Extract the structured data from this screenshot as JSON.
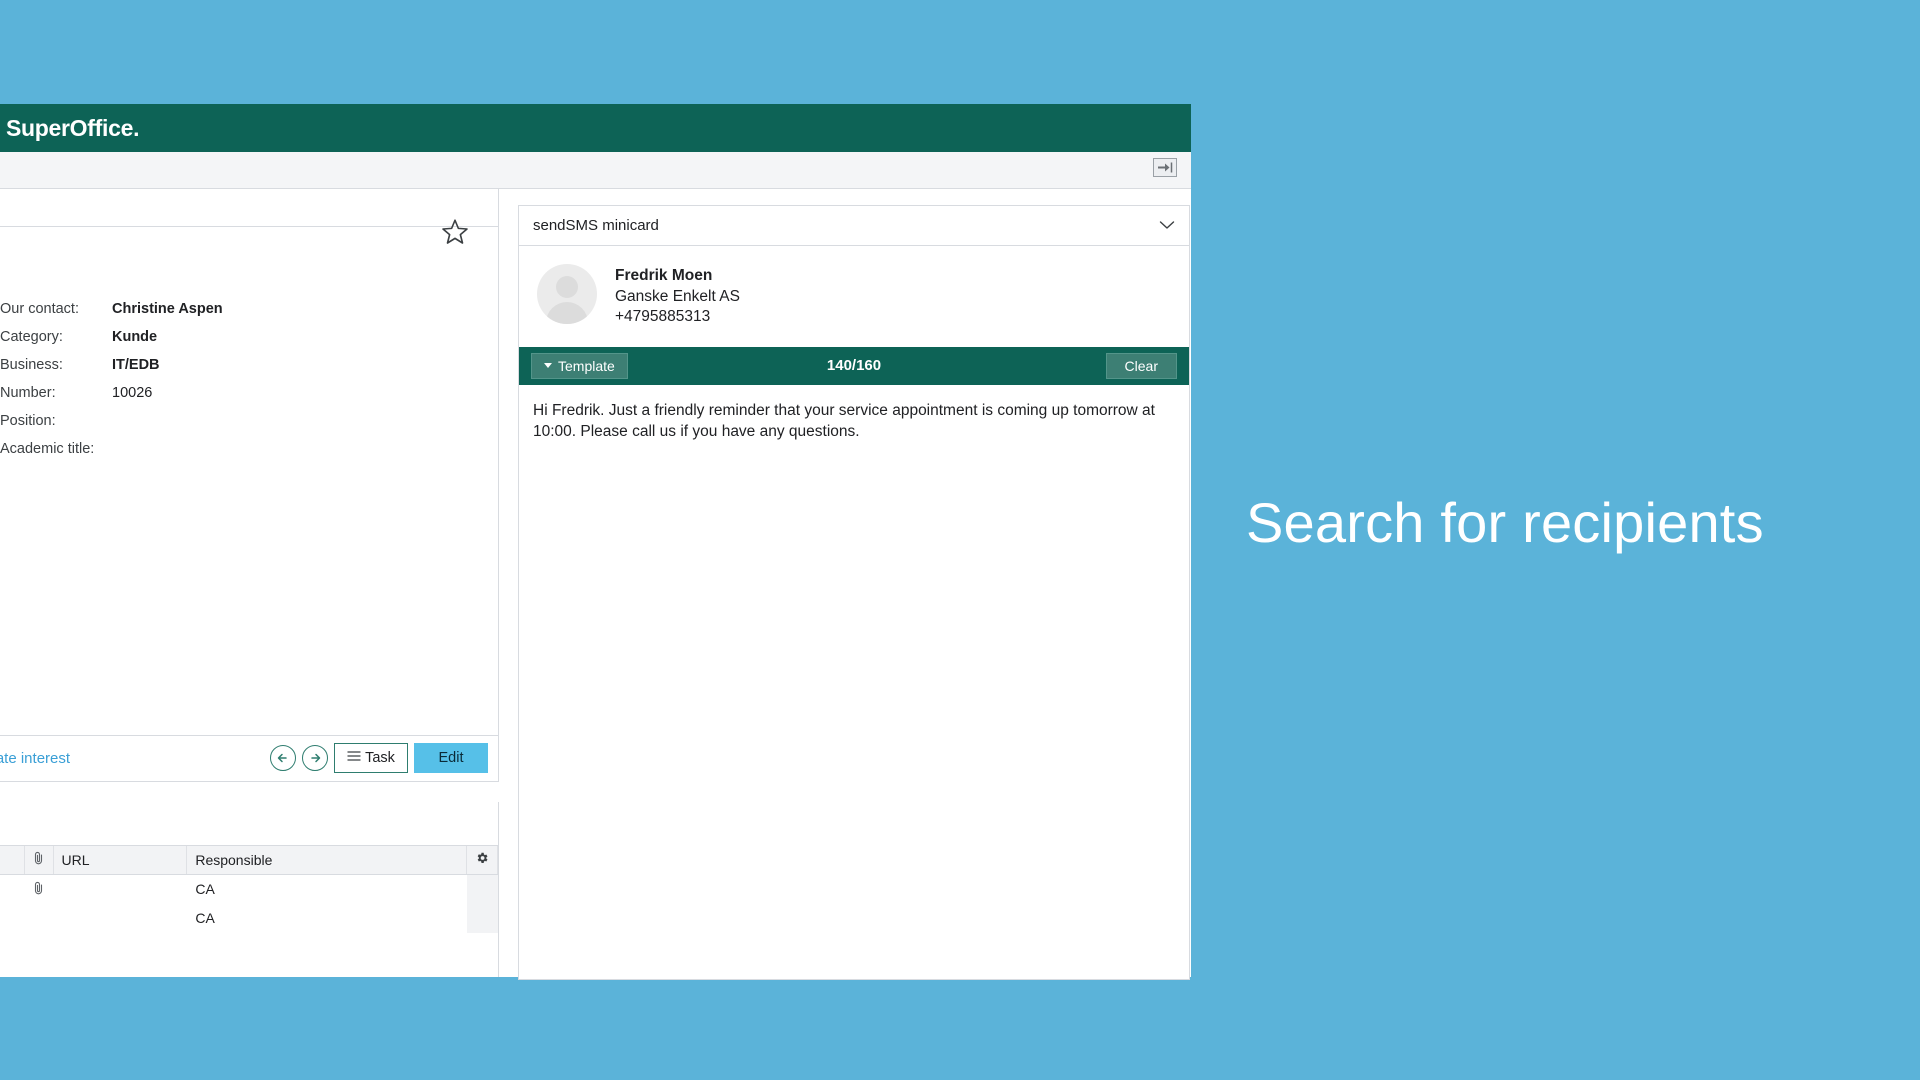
{
  "app": {
    "logo_text": "SuperOffice",
    "logo_dot": ".",
    "expand_icon": "expand-panel-icon"
  },
  "contact_card": {
    "star_icon": "favorite-star-icon",
    "fields": [
      {
        "label": "Our contact:",
        "value": "Christine Aspen"
      },
      {
        "label": "Category:",
        "value": "Kunde"
      },
      {
        "label": "Business:",
        "value": "IT/EDB"
      },
      {
        "label": "Number:",
        "value": "10026"
      },
      {
        "label": "Position:",
        "value": ""
      },
      {
        "label": "Academic title:",
        "value": ""
      }
    ],
    "actions": {
      "interest_link": "imate interest",
      "prev_icon": "arrow-left-icon",
      "next_icon": "arrow-right-icon",
      "task_label": "Task",
      "task_icon": "hamburger-menu-icon",
      "edit_label": "Edit"
    }
  },
  "documents_table": {
    "gear_icon": "settings-gear-icon",
    "clip_icon": "paperclip-icon",
    "columns": [
      "",
      "",
      "URL",
      "Responsible",
      ""
    ],
    "rows": [
      {
        "clip": "paperclip-icon",
        "url": "",
        "responsible": "CA"
      },
      {
        "clip": "",
        "url": "",
        "responsible": "CA"
      }
    ]
  },
  "sms_panel": {
    "title": "sendSMS minicard",
    "collapse_icon": "chevron-down-icon",
    "avatar_icon": "person-avatar-icon",
    "contact": {
      "name": "Fredrik Moen",
      "company": "Ganske Enkelt AS",
      "phone": "+4795885313"
    },
    "toolbar": {
      "template_label": "Template",
      "template_caret": "caret-down-icon",
      "char_count": "140/160",
      "clear_label": "Clear"
    },
    "message": "Hi Fredrik. Just a friendly reminder that your service appointment is coming up tomorrow at 10:00. Please call us if you have any questions."
  },
  "overlay": {
    "caption": "Search for recipients"
  },
  "colors": {
    "background_blue": "#5bb3d9",
    "brand_green": "#0d6356",
    "accent_blue": "#56c0e8",
    "link_blue": "#3a9fd6"
  }
}
